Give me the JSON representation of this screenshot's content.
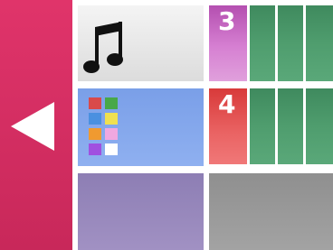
{
  "back_panel": {
    "icon": "back-arrow-icon",
    "color": "#d82f63"
  },
  "music_tile": {
    "icon": "music-note-icon"
  },
  "counters": [
    {
      "label": "3",
      "color": "#c060bc"
    },
    {
      "label": "4",
      "color": "#e04848"
    }
  ],
  "palette_tile": {
    "icon": "color-palette-icon",
    "swatches": [
      "#d94a4a",
      "#48a848",
      "#4a90e0",
      "#f0e050",
      "#f09a30",
      "#f0a8e0",
      "#a050e0",
      "#ffffff"
    ]
  },
  "colors": {
    "green_tile": "#4a9a6a",
    "purple_tile": "#9888bd",
    "gray_tile": "#9a9a9a"
  }
}
